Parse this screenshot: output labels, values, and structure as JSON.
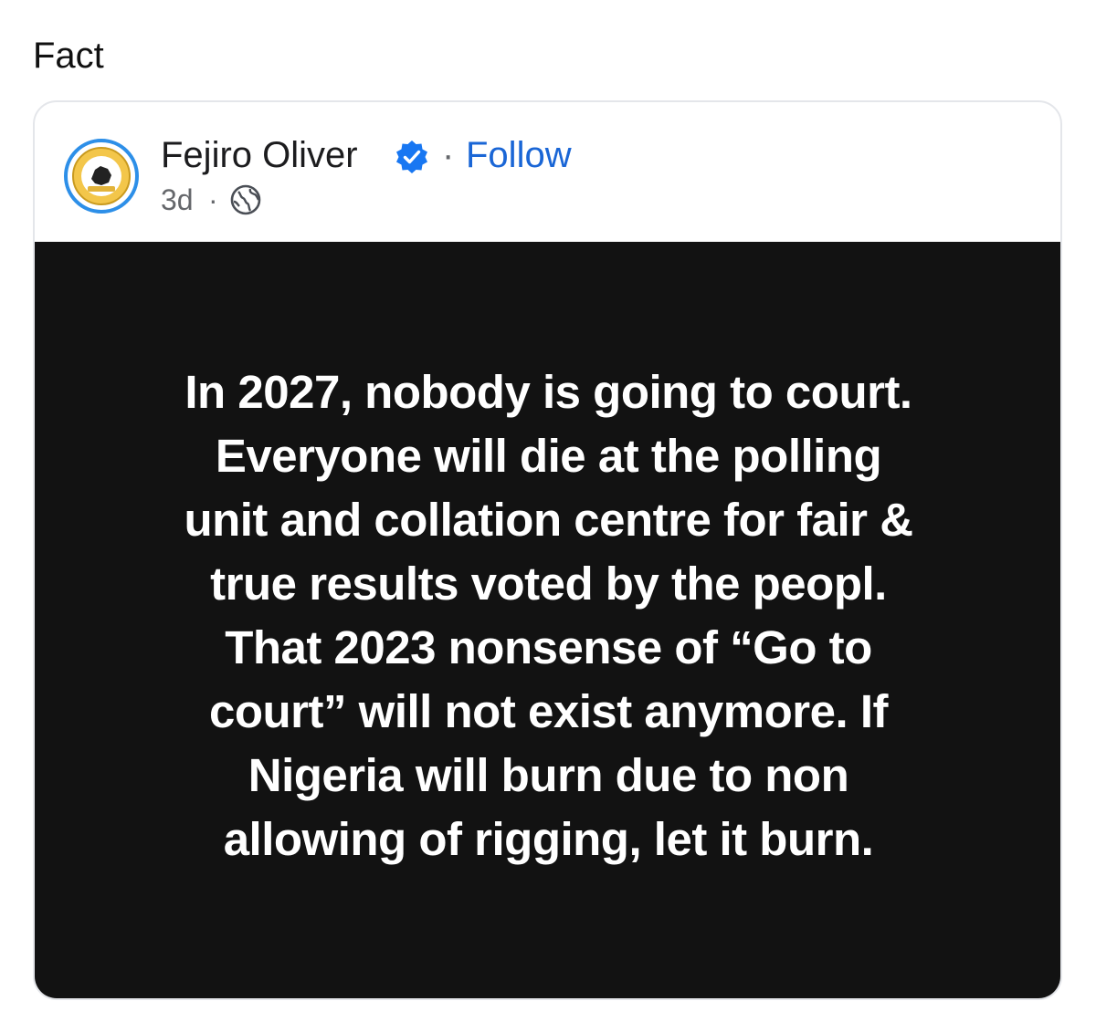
{
  "caption": "Fact",
  "post": {
    "author": "Fejiro Oliver",
    "separator": "·",
    "follow_label": "Follow",
    "time": "3d",
    "meta_separator": "·",
    "audience_icon": "globe-icon",
    "verified_icon": "verified-badge-icon",
    "avatar_icon": "logo-avatar",
    "image_text": "In 2027, nobody is going to court.\nEveryone will die at the polling\nunit and collation centre for fair &\ntrue results voted by the peopl.\nThat 2023 nonsense of “Go to\ncourt” will not exist anymore. If\nNigeria will burn due to non\nallowing of rigging, let it burn."
  },
  "colors": {
    "follow": "#1a66d6",
    "verified": "#1877f2",
    "image_background": "#121212",
    "avatar_ring": "#2d8fe8"
  }
}
